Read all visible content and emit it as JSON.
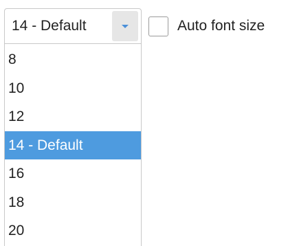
{
  "font_size_select": {
    "value": "14 - Default",
    "options": [
      {
        "label": "8",
        "selected": false
      },
      {
        "label": "10",
        "selected": false
      },
      {
        "label": "12",
        "selected": false
      },
      {
        "label": "14 - Default",
        "selected": true
      },
      {
        "label": "16",
        "selected": false
      },
      {
        "label": "18",
        "selected": false
      },
      {
        "label": "20",
        "selected": false
      }
    ],
    "arrow_icon": "chevron-down-icon",
    "arrow_color": "#4a90d9"
  },
  "auto_font_size": {
    "label": "Auto font size",
    "checked": false
  },
  "colors": {
    "highlight": "#4e9bdf",
    "highlight_text": "#ffffff"
  }
}
